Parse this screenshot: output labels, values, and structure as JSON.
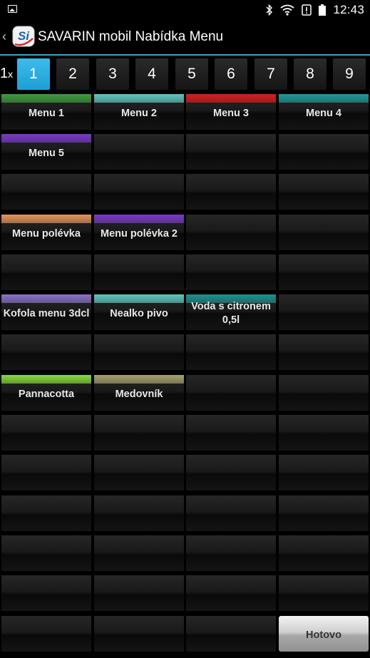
{
  "status_bar": {
    "time": "12:43",
    "icons": [
      "image-icon",
      "bluetooth-icon",
      "wifi-icon",
      "alert-icon",
      "battery-icon"
    ]
  },
  "action_bar": {
    "back": "‹",
    "title": "SAVARIN mobil Nabídka Menu",
    "logo_text": "Si"
  },
  "accent_color": "#2ea7d8",
  "quantity": {
    "value": "1",
    "suffix": "x"
  },
  "pages": [
    "1",
    "2",
    "3",
    "4",
    "5",
    "6",
    "7",
    "8",
    "9"
  ],
  "active_page": "1",
  "menu_items": [
    {
      "label": "Menu 1",
      "color": "#3e9b3e"
    },
    {
      "label": "Menu 2",
      "color": "#5fc7c0"
    },
    {
      "label": "Menu 3",
      "color": "#d81e1e"
    },
    {
      "label": "Menu 4",
      "color": "#1f9a9a"
    },
    {
      "label": "Menu 5",
      "color": "#7a3ac8"
    },
    {
      "label": "Menu polévka",
      "color": "#e4955a"
    },
    {
      "label": "Menu polévka 2",
      "color": "#7a3ac8"
    },
    {
      "label": "Kofola menu 3dcl",
      "color": "#8a72c8"
    },
    {
      "label": "Nealko pivo",
      "color": "#5fc7c0"
    },
    {
      "label": "Voda s citronem 0,5l",
      "color": "#1f8f8f"
    },
    {
      "label": "Pannacotta",
      "color": "#86d93a"
    },
    {
      "label": "Medovník",
      "color": "#a6a26e"
    }
  ],
  "done_button": {
    "label": "Hotovo"
  }
}
